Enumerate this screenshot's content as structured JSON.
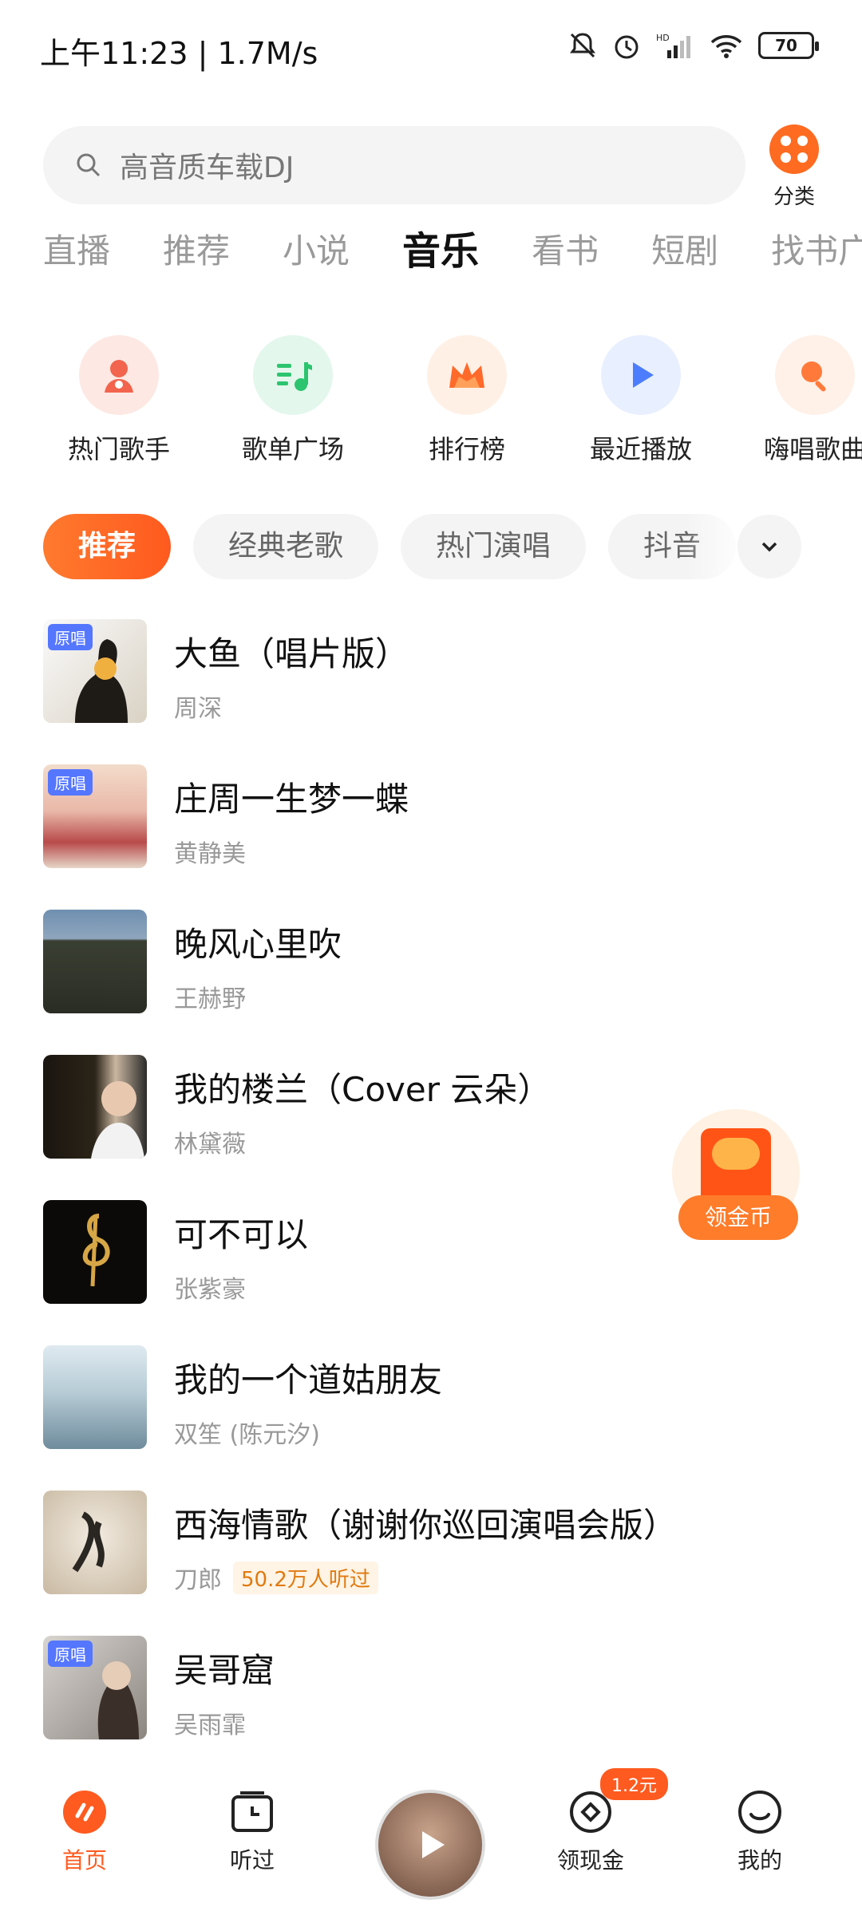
{
  "status_bar": {
    "time": "上午11:23 | 1.7M/s",
    "battery": "70"
  },
  "search": {
    "placeholder": "高音质车载DJ",
    "category_label": "分类"
  },
  "top_tabs": [
    "直播",
    "推荐",
    "小说",
    "音乐",
    "看书",
    "短剧",
    "找书广场"
  ],
  "top_tabs_active": "音乐",
  "quick_entries": [
    {
      "label": "热门歌手",
      "icon": "singer-icon",
      "bg": "#fde8e3",
      "color": "#f2644e"
    },
    {
      "label": "歌单广场",
      "icon": "playlist-icon",
      "bg": "#e3f7ec",
      "color": "#2cc46f"
    },
    {
      "label": "排行榜",
      "icon": "crown-icon",
      "bg": "#fff0e6",
      "color": "#ff6a2a"
    },
    {
      "label": "最近播放",
      "icon": "play-icon",
      "bg": "#e8efff",
      "color": "#4d7dff"
    },
    {
      "label": "嗨唱歌曲",
      "icon": "sing-icon",
      "bg": "#fff0e8",
      "color": "#ff7a3a"
    }
  ],
  "chips": [
    {
      "label": "推荐",
      "active": true
    },
    {
      "label": "经典老歌",
      "active": false
    },
    {
      "label": "热门演唱",
      "active": false
    },
    {
      "label": "抖音",
      "active": false
    }
  ],
  "songs": [
    {
      "title": "大鱼（唱片版）",
      "artist": "周深",
      "tag": "原唱",
      "badge": ""
    },
    {
      "title": "庄周一生梦一蝶",
      "artist": "黄静美",
      "tag": "原唱",
      "badge": ""
    },
    {
      "title": "晚风心里吹",
      "artist": "王赫野",
      "tag": "",
      "badge": ""
    },
    {
      "title": "我的楼兰（Cover 云朵）",
      "artist": "林黛薇",
      "tag": "",
      "badge": ""
    },
    {
      "title": "可不可以",
      "artist": "张紫豪",
      "tag": "",
      "badge": ""
    },
    {
      "title": "我的一个道姑朋友",
      "artist": "双笙 (陈元汐)",
      "tag": "",
      "badge": ""
    },
    {
      "title": "西海情歌（谢谢你巡回演唱会版）",
      "artist": "刀郎",
      "tag": "",
      "badge": "50.2万人听过"
    },
    {
      "title": "吴哥窟",
      "artist": "吴雨霏",
      "tag": "原唱",
      "badge": ""
    }
  ],
  "coin_float": {
    "label": "领金币"
  },
  "bottom_nav": {
    "home": "首页",
    "history": "听过",
    "cash": "领现金",
    "cash_badge": "1.2元",
    "mine": "我的"
  },
  "colors": {
    "accent": "#ff5a1f",
    "tag": "#5577ff"
  }
}
